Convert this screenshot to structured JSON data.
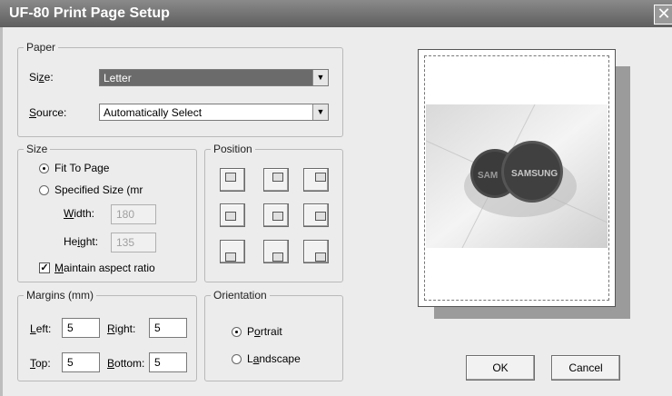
{
  "window": {
    "title": "UF-80 Print Page Setup",
    "close_glyph": "✕"
  },
  "paper": {
    "legend": "Paper",
    "size_label_pre": "Si",
    "size_label_u": "z",
    "size_label_post": "e:",
    "size_value": "Letter",
    "source_label_u": "S",
    "source_label_post": "ource:",
    "source_value": "Automatically Select"
  },
  "size": {
    "legend": "Size",
    "fit_to_page": "Fit To Page",
    "specified": "Specified Size (mr",
    "width_label_u": "W",
    "width_label_post": "idth:",
    "width_value": "180",
    "height_label_pre": "He",
    "height_label_u": "i",
    "height_label_post": "ght:",
    "height_value": "135",
    "maintain_u": "M",
    "maintain_post": "aintain aspect ratio",
    "maintain_checked": true
  },
  "position": {
    "legend": "Position",
    "selected": "top-left"
  },
  "margins": {
    "legend": "Margins (mm)",
    "left_u": "L",
    "left_post": "eft:",
    "left_value": "5",
    "right_u": "R",
    "right_post": "ight:",
    "right_value": "5",
    "top_u": "T",
    "top_post": "op:",
    "top_value": "5",
    "bottom_u": "B",
    "bottom_post": "ottom:",
    "bottom_value": "5"
  },
  "orientation": {
    "legend": "Orientation",
    "portrait_pre": "P",
    "portrait_u": "o",
    "portrait_post": "rtrait",
    "landscape_pre": "L",
    "landscape_u": "a",
    "landscape_post": "ndscape",
    "selected": "portrait"
  },
  "preview": {
    "photo_text_1": "SAMSUNG",
    "photo_text_2": "SAM"
  },
  "buttons": {
    "ok": "OK",
    "cancel": "Cancel"
  },
  "icons": {
    "dropdown": "chevron-down-icon",
    "close": "close-icon",
    "position_cell": "page-position-icon"
  }
}
